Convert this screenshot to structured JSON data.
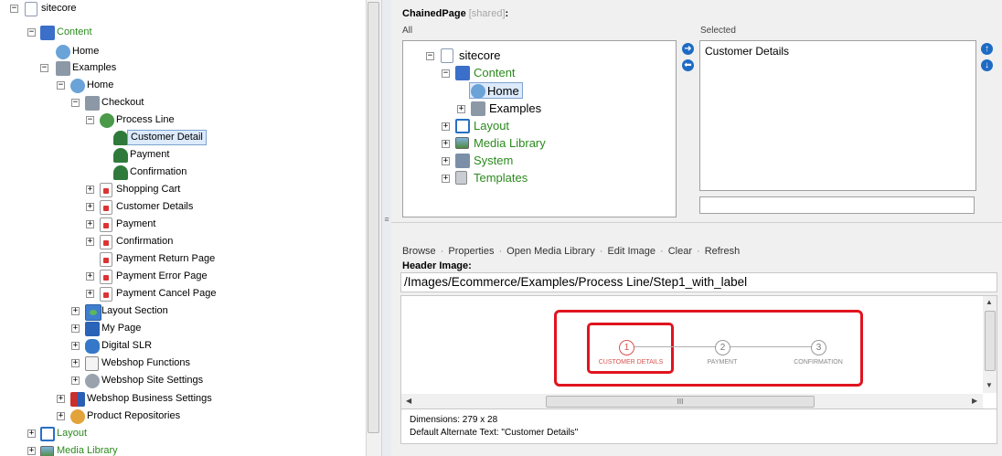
{
  "tree": {
    "root": "sitecore",
    "content": "Content",
    "home1": "Home",
    "examples": "Examples",
    "home2": "Home",
    "checkout": "Checkout",
    "process_line": "Process Line",
    "customer_detail": "Customer Detail",
    "payment_child": "Payment",
    "confirmation_child": "Confirmation",
    "shopping_cart": "Shopping Cart",
    "customer_details": "Customer Details",
    "payment": "Payment",
    "confirmation": "Confirmation",
    "payment_return": "Payment Return Page",
    "payment_error": "Payment Error Page",
    "payment_cancel": "Payment Cancel Page",
    "layout_section": "Layout Section",
    "my_page": "My Page",
    "digital_slr": "Digital SLR",
    "webshop_functions": "Webshop Functions",
    "webshop_site_settings": "Webshop Site Settings",
    "webshop_business_settings": "Webshop Business Settings",
    "product_repositories": "Product Repositories",
    "layout": "Layout",
    "media_library": "Media Library"
  },
  "chained": {
    "field_title": "ChainedPage",
    "shared_tag": "[shared]",
    "colon": ":",
    "all_label": "All",
    "selected_label": "Selected",
    "all_tree": {
      "root": "sitecore",
      "content": "Content",
      "home": "Home",
      "examples": "Examples",
      "layout": "Layout",
      "media_library": "Media Library",
      "system": "System",
      "templates": "Templates"
    },
    "selected_items": [
      "Customer Details"
    ],
    "filter_value": ""
  },
  "image_field": {
    "actions": [
      "Browse",
      "Properties",
      "Open Media Library",
      "Edit Image",
      "Clear",
      "Refresh"
    ],
    "title": "Header Image:",
    "path": "/Images/Ecommerce/Examples/Process Line/Step1_with_label",
    "steps": [
      {
        "num": "1",
        "label": "CUSTOMER DETAILS"
      },
      {
        "num": "2",
        "label": "PAYMENT"
      },
      {
        "num": "3",
        "label": "CONFIRMATION"
      }
    ],
    "dimensions": "Dimensions: 279 x 28",
    "alt_text": "Default Alternate Text: \"Customer Details\"",
    "hscroll_grip": "III"
  },
  "colors": {
    "accent_blue": "#1e6bc4",
    "tree_green": "#2b8a1e",
    "highlight_red": "#e0141e",
    "step_active": "#d9534f"
  }
}
